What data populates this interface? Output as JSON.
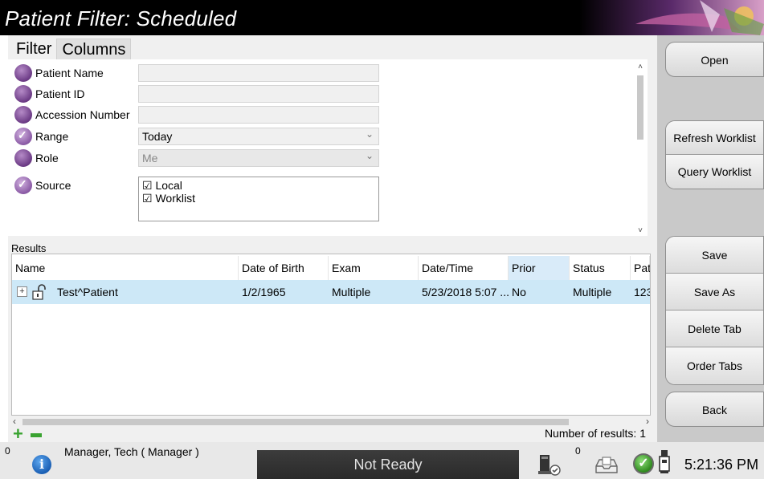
{
  "title": "Patient Filter: Scheduled",
  "tabs": [
    "Filter",
    "Columns"
  ],
  "filter": {
    "rows": [
      {
        "label": "Patient Name",
        "checked": false,
        "value": ""
      },
      {
        "label": "Patient ID",
        "checked": false,
        "value": ""
      },
      {
        "label": "Accession Number",
        "checked": false,
        "value": ""
      },
      {
        "label": "Range",
        "checked": true,
        "value": "Today"
      },
      {
        "label": "Role",
        "checked": false,
        "value": "Me"
      },
      {
        "label": "Source",
        "checked": true,
        "value": ""
      }
    ],
    "sources": [
      "☑ Local",
      "☑ Worklist"
    ]
  },
  "results": {
    "label": "Results",
    "columns": [
      "Name",
      "Date of Birth",
      "Exam",
      "Date/Time",
      "Prior",
      "Status",
      "Pat"
    ],
    "rows": [
      {
        "name": "Test^Patient",
        "dob": "1/2/1965",
        "exam": "Multiple",
        "datetime": "5/23/2018 5:07 ...",
        "prior": "No",
        "status": "Multiple",
        "pat": "123"
      }
    ],
    "count_text": "Number of results: 1"
  },
  "buttons": {
    "open": "Open",
    "refresh": "Refresh Worklist",
    "query": "Query Worklist",
    "save": "Save",
    "save_as": "Save As",
    "delete_tab": "Delete Tab",
    "order_tabs": "Order Tabs",
    "back": "Back"
  },
  "status": {
    "count_left": "0",
    "user": "Manager, Tech ( Manager )",
    "state": "Not Ready",
    "count_right": "0",
    "time": "5:21:36 PM"
  },
  "colors": {
    "selected_row": "#cde8f7",
    "radio_purple": "#6b3a85",
    "add_green": "#3aa331"
  }
}
